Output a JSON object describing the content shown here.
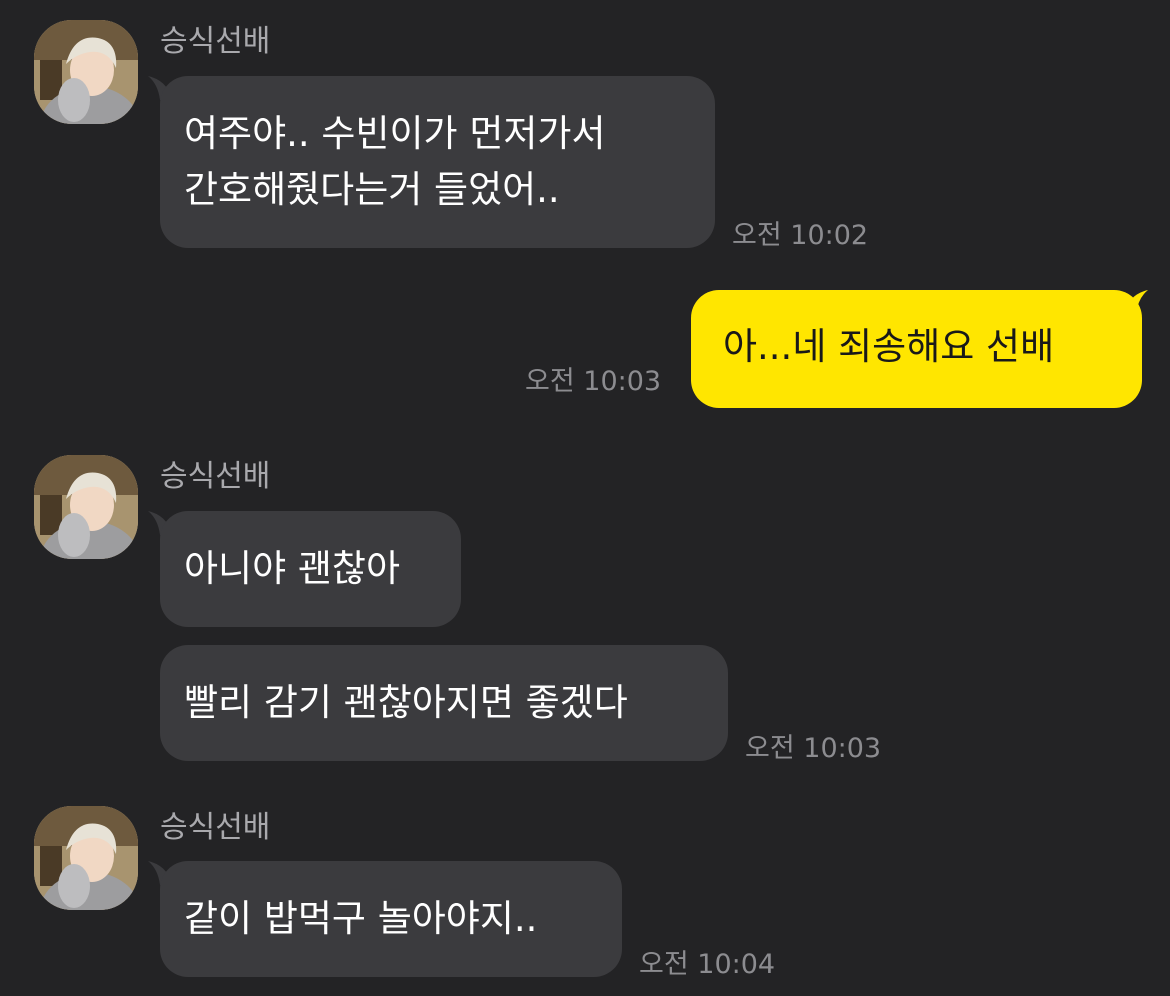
{
  "chat": {
    "colors": {
      "background": "#232325",
      "incoming_bubble": "#3b3b3e",
      "outgoing_bubble": "#ffe600",
      "time_text": "#8c8c90",
      "sender_text": "#a9a9ad"
    },
    "groups": [
      {
        "sender": "승식선배",
        "avatar_icon": "profile-photo",
        "messages": [
          {
            "line1": "여주야.. 수빈이가 먼저가서",
            "line2": "간호해줬다는거 들었어.."
          }
        ],
        "time": "오전 10:02"
      },
      {
        "outgoing": true,
        "messages": [
          {
            "text": "아...네 죄송해요 선배"
          }
        ],
        "time": "오전 10:03"
      },
      {
        "sender": "승식선배",
        "avatar_icon": "profile-photo",
        "messages": [
          {
            "text": "아니야 괜찮아"
          },
          {
            "text": "빨리 감기 괜찮아지면 좋겠다"
          }
        ],
        "time": "오전 10:03"
      },
      {
        "sender": "승식선배",
        "avatar_icon": "profile-photo",
        "messages": [
          {
            "text": "같이 밥먹구 놀아야지.."
          }
        ],
        "time": "오전 10:04"
      }
    ]
  }
}
